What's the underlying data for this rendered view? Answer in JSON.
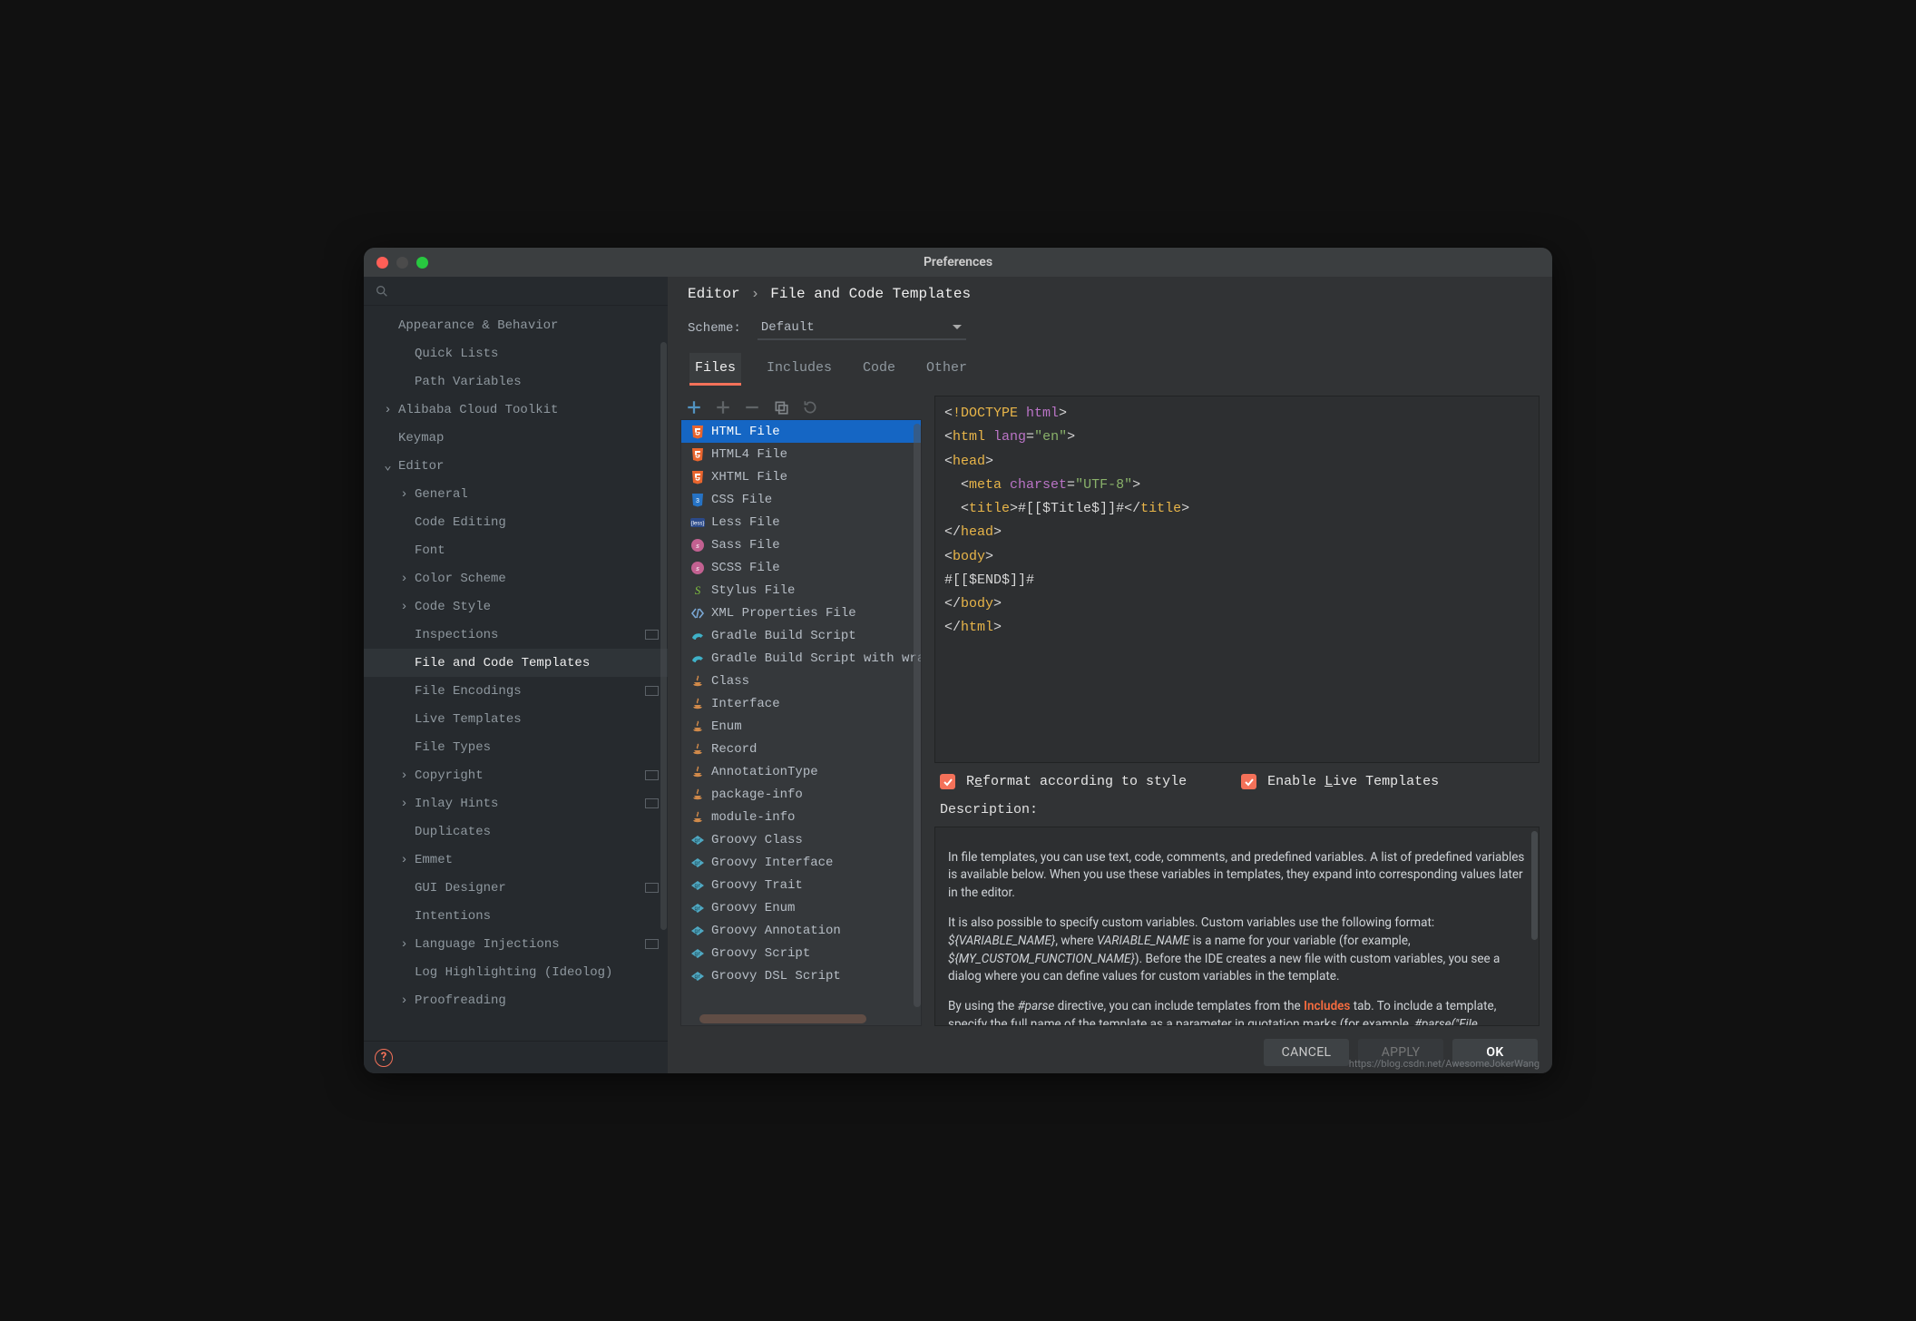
{
  "window": {
    "title": "Preferences"
  },
  "search": {
    "placeholder": ""
  },
  "tree": [
    {
      "label": "Appearance & Behavior",
      "level": 0,
      "exp": false,
      "chev": false,
      "badge": false
    },
    {
      "label": "Quick Lists",
      "level": 1,
      "exp": false,
      "chev": false,
      "badge": false
    },
    {
      "label": "Path Variables",
      "level": 1,
      "exp": false,
      "chev": false,
      "badge": false
    },
    {
      "label": "Alibaba Cloud Toolkit",
      "level": 0,
      "exp": false,
      "chev": true,
      "badge": false
    },
    {
      "label": "Keymap",
      "level": 0,
      "exp": false,
      "chev": false,
      "badge": false
    },
    {
      "label": "Editor",
      "level": 0,
      "exp": true,
      "chev": true,
      "badge": false
    },
    {
      "label": "General",
      "level": 1,
      "exp": false,
      "chev": true,
      "badge": false
    },
    {
      "label": "Code Editing",
      "level": 2,
      "exp": false,
      "chev": false,
      "badge": false
    },
    {
      "label": "Font",
      "level": 2,
      "exp": false,
      "chev": false,
      "badge": false
    },
    {
      "label": "Color Scheme",
      "level": 1,
      "exp": false,
      "chev": true,
      "badge": false
    },
    {
      "label": "Code Style",
      "level": 1,
      "exp": false,
      "chev": true,
      "badge": false
    },
    {
      "label": "Inspections",
      "level": 2,
      "exp": false,
      "chev": false,
      "badge": true
    },
    {
      "label": "File and Code Templates",
      "level": 2,
      "exp": false,
      "chev": false,
      "badge": false,
      "active": true
    },
    {
      "label": "File Encodings",
      "level": 2,
      "exp": false,
      "chev": false,
      "badge": true
    },
    {
      "label": "Live Templates",
      "level": 2,
      "exp": false,
      "chev": false,
      "badge": false
    },
    {
      "label": "File Types",
      "level": 2,
      "exp": false,
      "chev": false,
      "badge": false
    },
    {
      "label": "Copyright",
      "level": 1,
      "exp": false,
      "chev": true,
      "badge": true
    },
    {
      "label": "Inlay Hints",
      "level": 1,
      "exp": false,
      "chev": true,
      "badge": true
    },
    {
      "label": "Duplicates",
      "level": 2,
      "exp": false,
      "chev": false,
      "badge": false
    },
    {
      "label": "Emmet",
      "level": 1,
      "exp": false,
      "chev": true,
      "badge": false
    },
    {
      "label": "GUI Designer",
      "level": 2,
      "exp": false,
      "chev": false,
      "badge": true
    },
    {
      "label": "Intentions",
      "level": 2,
      "exp": false,
      "chev": false,
      "badge": false
    },
    {
      "label": "Language Injections",
      "level": 1,
      "exp": false,
      "chev": true,
      "badge": true
    },
    {
      "label": "Log Highlighting (Ideolog)",
      "level": 2,
      "exp": false,
      "chev": false,
      "badge": false
    },
    {
      "label": "Proofreading",
      "level": 1,
      "exp": false,
      "chev": true,
      "badge": false
    }
  ],
  "breadcrumb": {
    "section": "Editor",
    "page": "File and Code Templates"
  },
  "scheme": {
    "label": "Scheme:",
    "value": "Default"
  },
  "tabs": [
    {
      "label": "Files",
      "active": true
    },
    {
      "label": "Includes",
      "active": false
    },
    {
      "label": "Code",
      "active": false
    },
    {
      "label": "Other",
      "active": false
    }
  ],
  "templates": [
    {
      "label": "HTML File",
      "icon": "html5",
      "selected": true
    },
    {
      "label": "HTML4 File",
      "icon": "html5"
    },
    {
      "label": "XHTML File",
      "icon": "html5"
    },
    {
      "label": "CSS File",
      "icon": "css"
    },
    {
      "label": "Less File",
      "icon": "less"
    },
    {
      "label": "Sass File",
      "icon": "sass"
    },
    {
      "label": "SCSS File",
      "icon": "sass"
    },
    {
      "label": "Stylus File",
      "icon": "stylus"
    },
    {
      "label": "XML Properties File",
      "icon": "xml"
    },
    {
      "label": "Gradle Build Script",
      "icon": "gradle"
    },
    {
      "label": "Gradle Build Script with wrapper",
      "icon": "gradle"
    },
    {
      "label": "Class",
      "icon": "java"
    },
    {
      "label": "Interface",
      "icon": "java"
    },
    {
      "label": "Enum",
      "icon": "java"
    },
    {
      "label": "Record",
      "icon": "java"
    },
    {
      "label": "AnnotationType",
      "icon": "java"
    },
    {
      "label": "package-info",
      "icon": "java"
    },
    {
      "label": "module-info",
      "icon": "java"
    },
    {
      "label": "Groovy Class",
      "icon": "groovy"
    },
    {
      "label": "Groovy Interface",
      "icon": "groovy"
    },
    {
      "label": "Groovy Trait",
      "icon": "groovy"
    },
    {
      "label": "Groovy Enum",
      "icon": "groovy"
    },
    {
      "label": "Groovy Annotation",
      "icon": "groovy"
    },
    {
      "label": "Groovy Script",
      "icon": "groovy"
    },
    {
      "label": "Groovy DSL Script",
      "icon": "groovy"
    }
  ],
  "code": {
    "lines": [
      [
        {
          "t": "<",
          "c": "ang"
        },
        {
          "t": "!DOCTYPE ",
          "c": "tagc"
        },
        {
          "t": "html",
          "c": "attrc"
        },
        {
          "t": ">",
          "c": "ang"
        }
      ],
      [
        {
          "t": "<",
          "c": "ang"
        },
        {
          "t": "html ",
          "c": "tagc"
        },
        {
          "t": "lang",
          "c": "attrc"
        },
        {
          "t": "=",
          "c": "ang"
        },
        {
          "t": "\"en\"",
          "c": "strc"
        },
        {
          "t": ">",
          "c": "ang"
        }
      ],
      [
        {
          "t": "<",
          "c": "ang"
        },
        {
          "t": "head",
          "c": "tagc"
        },
        {
          "t": ">",
          "c": "ang"
        }
      ],
      [
        {
          "t": "  <",
          "c": "ang"
        },
        {
          "t": "meta ",
          "c": "tagc"
        },
        {
          "t": "charset",
          "c": "attrc"
        },
        {
          "t": "=",
          "c": "ang"
        },
        {
          "t": "\"UTF-8\"",
          "c": "strc"
        },
        {
          "t": ">",
          "c": "ang"
        }
      ],
      [
        {
          "t": "  <",
          "c": "ang"
        },
        {
          "t": "title",
          "c": "tagc"
        },
        {
          "t": ">",
          "c": "ang"
        },
        {
          "t": "#[[$Title$]]#",
          "c": "txtc"
        },
        {
          "t": "</",
          "c": "ang"
        },
        {
          "t": "title",
          "c": "tagc"
        },
        {
          "t": ">",
          "c": "ang"
        }
      ],
      [
        {
          "t": "</",
          "c": "ang"
        },
        {
          "t": "head",
          "c": "tagc"
        },
        {
          "t": ">",
          "c": "ang"
        }
      ],
      [
        {
          "t": "<",
          "c": "ang"
        },
        {
          "t": "body",
          "c": "tagc"
        },
        {
          "t": ">",
          "c": "ang"
        }
      ],
      [
        {
          "t": "#[[$END$]]#",
          "c": "txtc"
        }
      ],
      [
        {
          "t": "</",
          "c": "ang"
        },
        {
          "t": "body",
          "c": "tagc"
        },
        {
          "t": ">",
          "c": "ang"
        }
      ],
      [
        {
          "t": "</",
          "c": "ang"
        },
        {
          "t": "html",
          "c": "tagc"
        },
        {
          "t": ">",
          "c": "ang"
        }
      ]
    ]
  },
  "options": {
    "reformat": {
      "checked": true,
      "pre": "R",
      "ul": "e",
      "post": "format according to style"
    },
    "live": {
      "checked": true,
      "pre1": "Enable ",
      "ul": "L",
      "post": "ive Templates"
    }
  },
  "description": {
    "label": "Description:",
    "p1": "In file templates, you can use text, code, comments, and predefined variables. A list of predefined variables is available below. When you use these variables in templates, they expand into corresponding values later in the editor.",
    "p2a": "It is also possible to specify custom variables. Custom variables use the following format: ",
    "p2v1": "${VARIABLE_NAME}",
    "p2b": ", where ",
    "p2v2": "VARIABLE_NAME",
    "p2c": " is a name for your variable (for example, ",
    "p2v3": "${MY_CUSTOM_FUNCTION_NAME}",
    "p2d": "). Before the IDE creates a new file with custom variables, you see a dialog where you can define values for custom variables in the template.",
    "p3a": "By using the ",
    "p3v1": "#parse",
    "p3b": " directive, you can include templates from the ",
    "p3link": "Includes",
    "p3c": " tab. To include a template, specify the full name of the template as a parameter in quotation marks (for example, ",
    "p3v2": "#parse(\"File Header\")",
    "p3d": ")."
  },
  "buttons": {
    "cancel": "CANCEL",
    "apply": "APPLY",
    "ok": "OK"
  },
  "watermark": "https://blog.csdn.net/AwesomeJokerWang"
}
